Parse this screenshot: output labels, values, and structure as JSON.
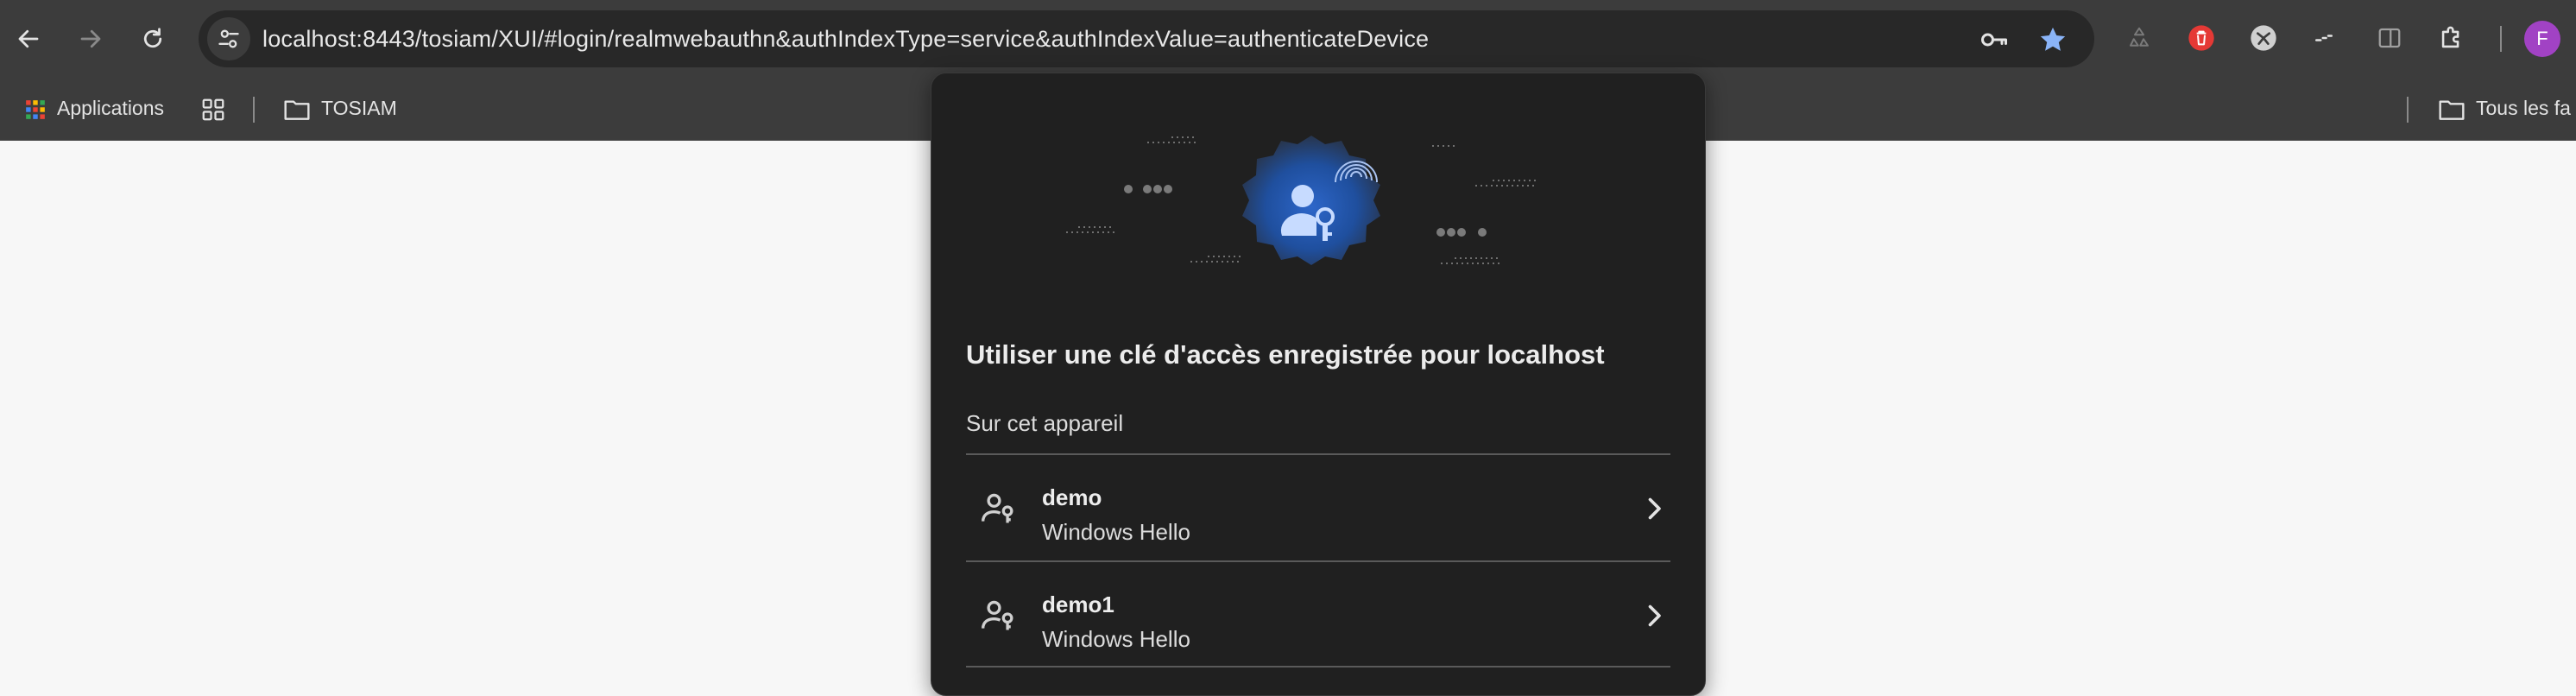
{
  "browser": {
    "url": "localhost:8443/tosiam/XUI/#login/realmwebauthn&authIndexType=service&authIndexValue=authenticateDevice",
    "profile_initial": "F"
  },
  "bookmarks": [
    {
      "label": "Applications",
      "icon": "apps-grid-icon"
    },
    {
      "label": "TOSIAM",
      "icon": "folder-icon"
    },
    {
      "label": "Tous les fa",
      "icon": "folder-icon"
    }
  ],
  "dialog": {
    "title": "Utiliser une clé d'accès enregistrée pour localhost",
    "subtitle": "Sur cet appareil",
    "items": [
      {
        "name": "demo",
        "provider": "Windows Hello"
      },
      {
        "name": "demo1",
        "provider": "Windows Hello"
      }
    ]
  },
  "colors": {
    "accent_blue": "#2d66c9",
    "star": "#8ab4f8",
    "avatar": "#a142c4",
    "extension_red": "#e53935"
  }
}
